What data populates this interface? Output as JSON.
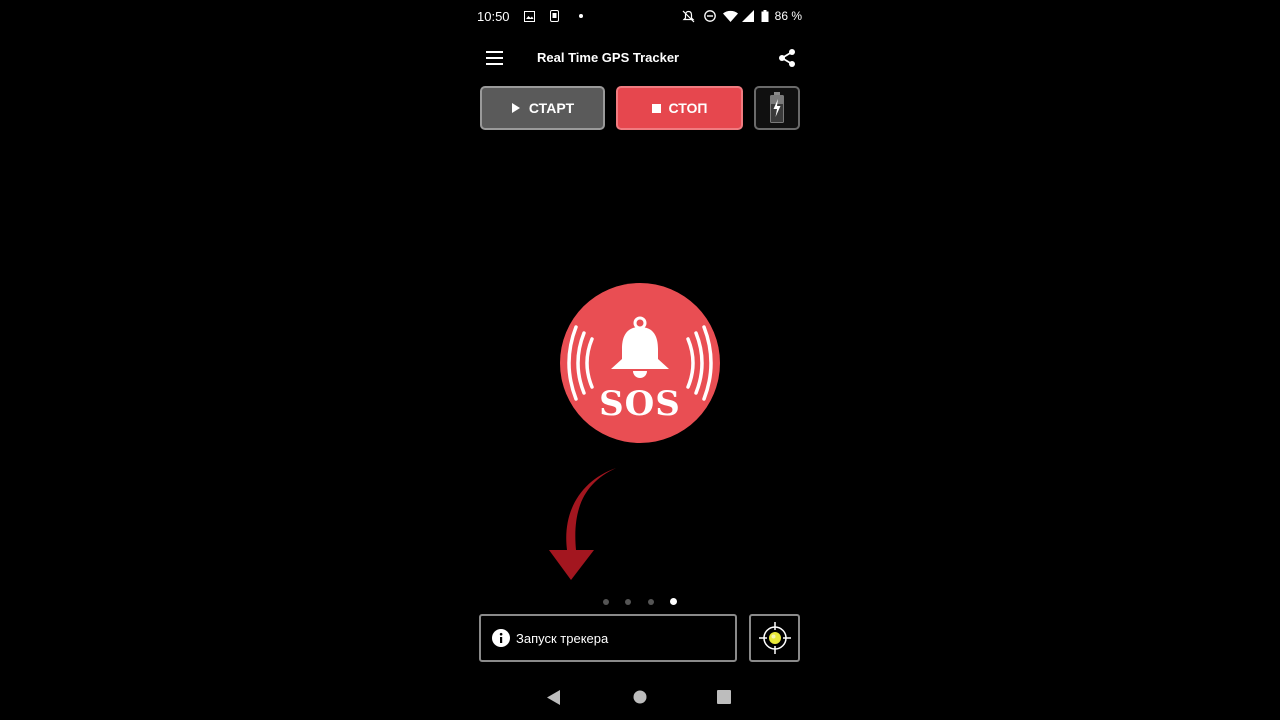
{
  "status_bar": {
    "time": "10:50",
    "battery_text": "86 %",
    "icons": [
      "photo-icon",
      "phone-frame-icon",
      "dot-icon",
      "notifications-off-icon",
      "do-not-disturb-icon",
      "wifi-icon",
      "signal-icon",
      "battery-icon"
    ]
  },
  "app_bar": {
    "title": "Real Time GPS Tracker",
    "icons": [
      "menu-icon",
      "share-icon"
    ]
  },
  "controls": {
    "start_label": "СТАРТ",
    "stop_label": "СТОП",
    "icons": [
      "play-icon",
      "stop-icon",
      "battery-charging-icon"
    ]
  },
  "sos": {
    "label": "SOS",
    "icon": "bell-icon"
  },
  "pager": {
    "count": 4,
    "active_index": 3
  },
  "info_bar": {
    "label": "Запуск трекера",
    "icon": "info-icon",
    "location_icon": "crosshair-icon"
  },
  "nav_bar": {
    "icons": [
      "back-icon",
      "home-icon",
      "recents-icon"
    ]
  },
  "colors": {
    "accent_red": "#e94e53",
    "stop_red": "#e6474e",
    "start_gray": "#5a5a5a",
    "arrow_red": "#a3161f",
    "location_dot": "#e9ea3a"
  }
}
